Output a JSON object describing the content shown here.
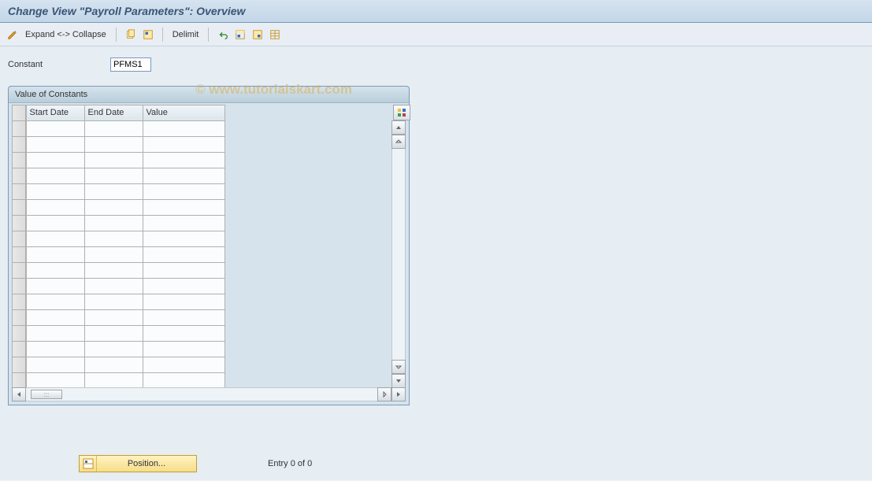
{
  "title": "Change View \"Payroll Parameters\": Overview",
  "toolbar": {
    "expand_collapse": "Expand <-> Collapse",
    "delimit": "Delimit"
  },
  "form": {
    "constant_label": "Constant",
    "constant_value": "PFMS1"
  },
  "panel": {
    "header": "Value of Constants",
    "columns": {
      "start": "Start Date",
      "end": "End Date",
      "value": "Value"
    },
    "rows": [
      "",
      "",
      "",
      "",
      "",
      "",
      "",
      "",
      "",
      "",
      "",
      "",
      "",
      "",
      "",
      "",
      ""
    ]
  },
  "footer": {
    "position_label": "Position...",
    "entry_counter": "Entry 0 of 0"
  },
  "watermark": "© www.tutorialskart.com"
}
